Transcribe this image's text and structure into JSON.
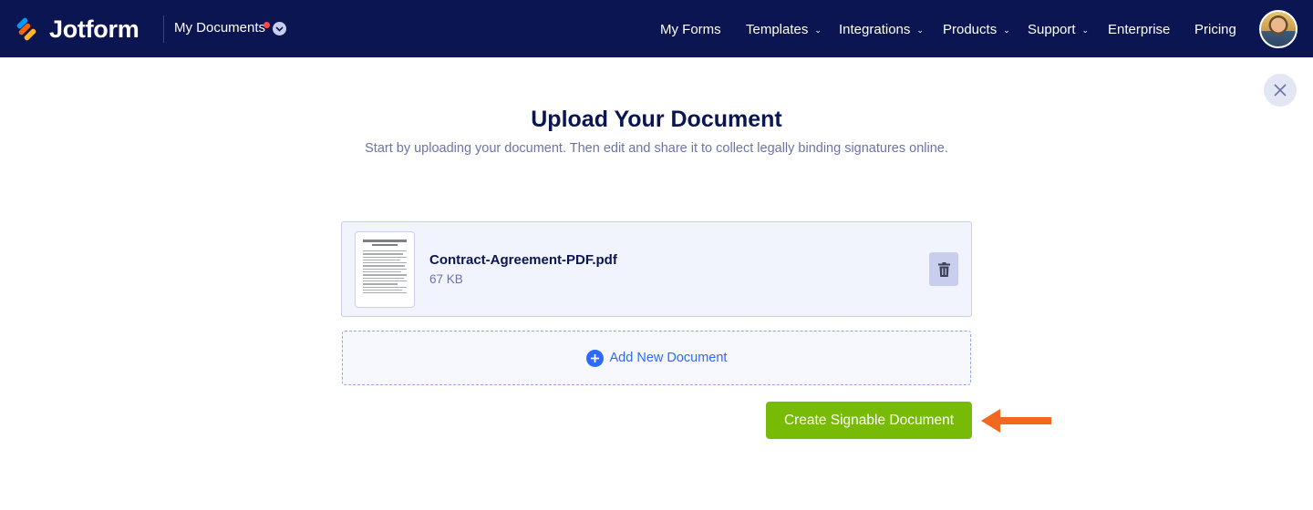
{
  "header": {
    "brand": "Jotform",
    "section_label": "My Documents",
    "nav": [
      {
        "label": "My Forms",
        "has_dropdown": false
      },
      {
        "label": "Templates",
        "has_dropdown": true
      },
      {
        "label": "Integrations",
        "has_dropdown": true
      },
      {
        "label": "Products",
        "has_dropdown": true
      },
      {
        "label": "Support",
        "has_dropdown": true
      },
      {
        "label": "Enterprise",
        "has_dropdown": false
      },
      {
        "label": "Pricing",
        "has_dropdown": false
      }
    ],
    "caret": "⌄"
  },
  "main": {
    "title": "Upload Your Document",
    "subtitle": "Start by uploading your document. Then edit and share it to collect legally binding signatures online.",
    "file": {
      "name": "Contract-Agreement-PDF.pdf",
      "size": "67 KB"
    },
    "add_label": "Add New Document",
    "create_label": "Create Signable Document"
  },
  "colors": {
    "header_bg": "#0a1551",
    "primary_button": "#78bb07",
    "accent_blue": "#2e69ff",
    "annotation_arrow": "#f4671f"
  },
  "icons": [
    "jotform-logo-icon",
    "chevron-down-icon",
    "close-icon",
    "trash-icon",
    "plus-circle-icon",
    "arrow-left-icon"
  ]
}
